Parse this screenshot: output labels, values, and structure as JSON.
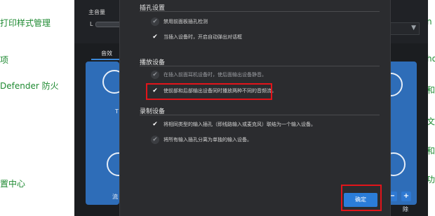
{
  "left_items": [
    {
      "label": "打印样式管理"
    },
    {
      "label": "项"
    },
    {
      "label": "Defender 防火"
    },
    {
      "label": "置中心"
    }
  ],
  "right_items": [
    {
      "label": "n"
    },
    {
      "label": "ho"
    },
    {
      "label": "和"
    },
    {
      "label": "文"
    },
    {
      "label": "和"
    },
    {
      "label": "功"
    }
  ],
  "background_app": {
    "master_volume_label": "主音量",
    "left_channel": "L",
    "tab_label": "音效",
    "tiles": [
      {
        "label": "T"
      },
      {
        "label": "流"
      },
      {
        "label": "除"
      }
    ],
    "minus_label": "−",
    "plus_label": "+"
  },
  "dialog": {
    "sections": [
      {
        "title": "插孔设置",
        "options": [
          {
            "label": "禁用前面板插孔检测",
            "checked": false
          },
          {
            "label": "当插入设备时，开启自动弹出对话框",
            "checked": true
          }
        ]
      },
      {
        "title": "播放设备",
        "options": [
          {
            "label": "在插入前面耳机设备时，使后面输出设备静音。",
            "checked": false
          },
          {
            "label": "使前部和后部输出设备同时播放两种不同的音频流。",
            "checked": true
          }
        ]
      },
      {
        "title": "录制设备",
        "options": [
          {
            "label": "将相同类型的输入插孔（即线路输入或麦克风）联结为一个输入设备。",
            "checked": true
          },
          {
            "label": "将所有输入插孔分离为单独的输入设备。",
            "checked": false
          }
        ]
      }
    ],
    "ok_label": "确定"
  },
  "colors": {
    "accent": "#2b7dd9",
    "highlight": "#e2141a",
    "link_green": "#1f8a32"
  }
}
